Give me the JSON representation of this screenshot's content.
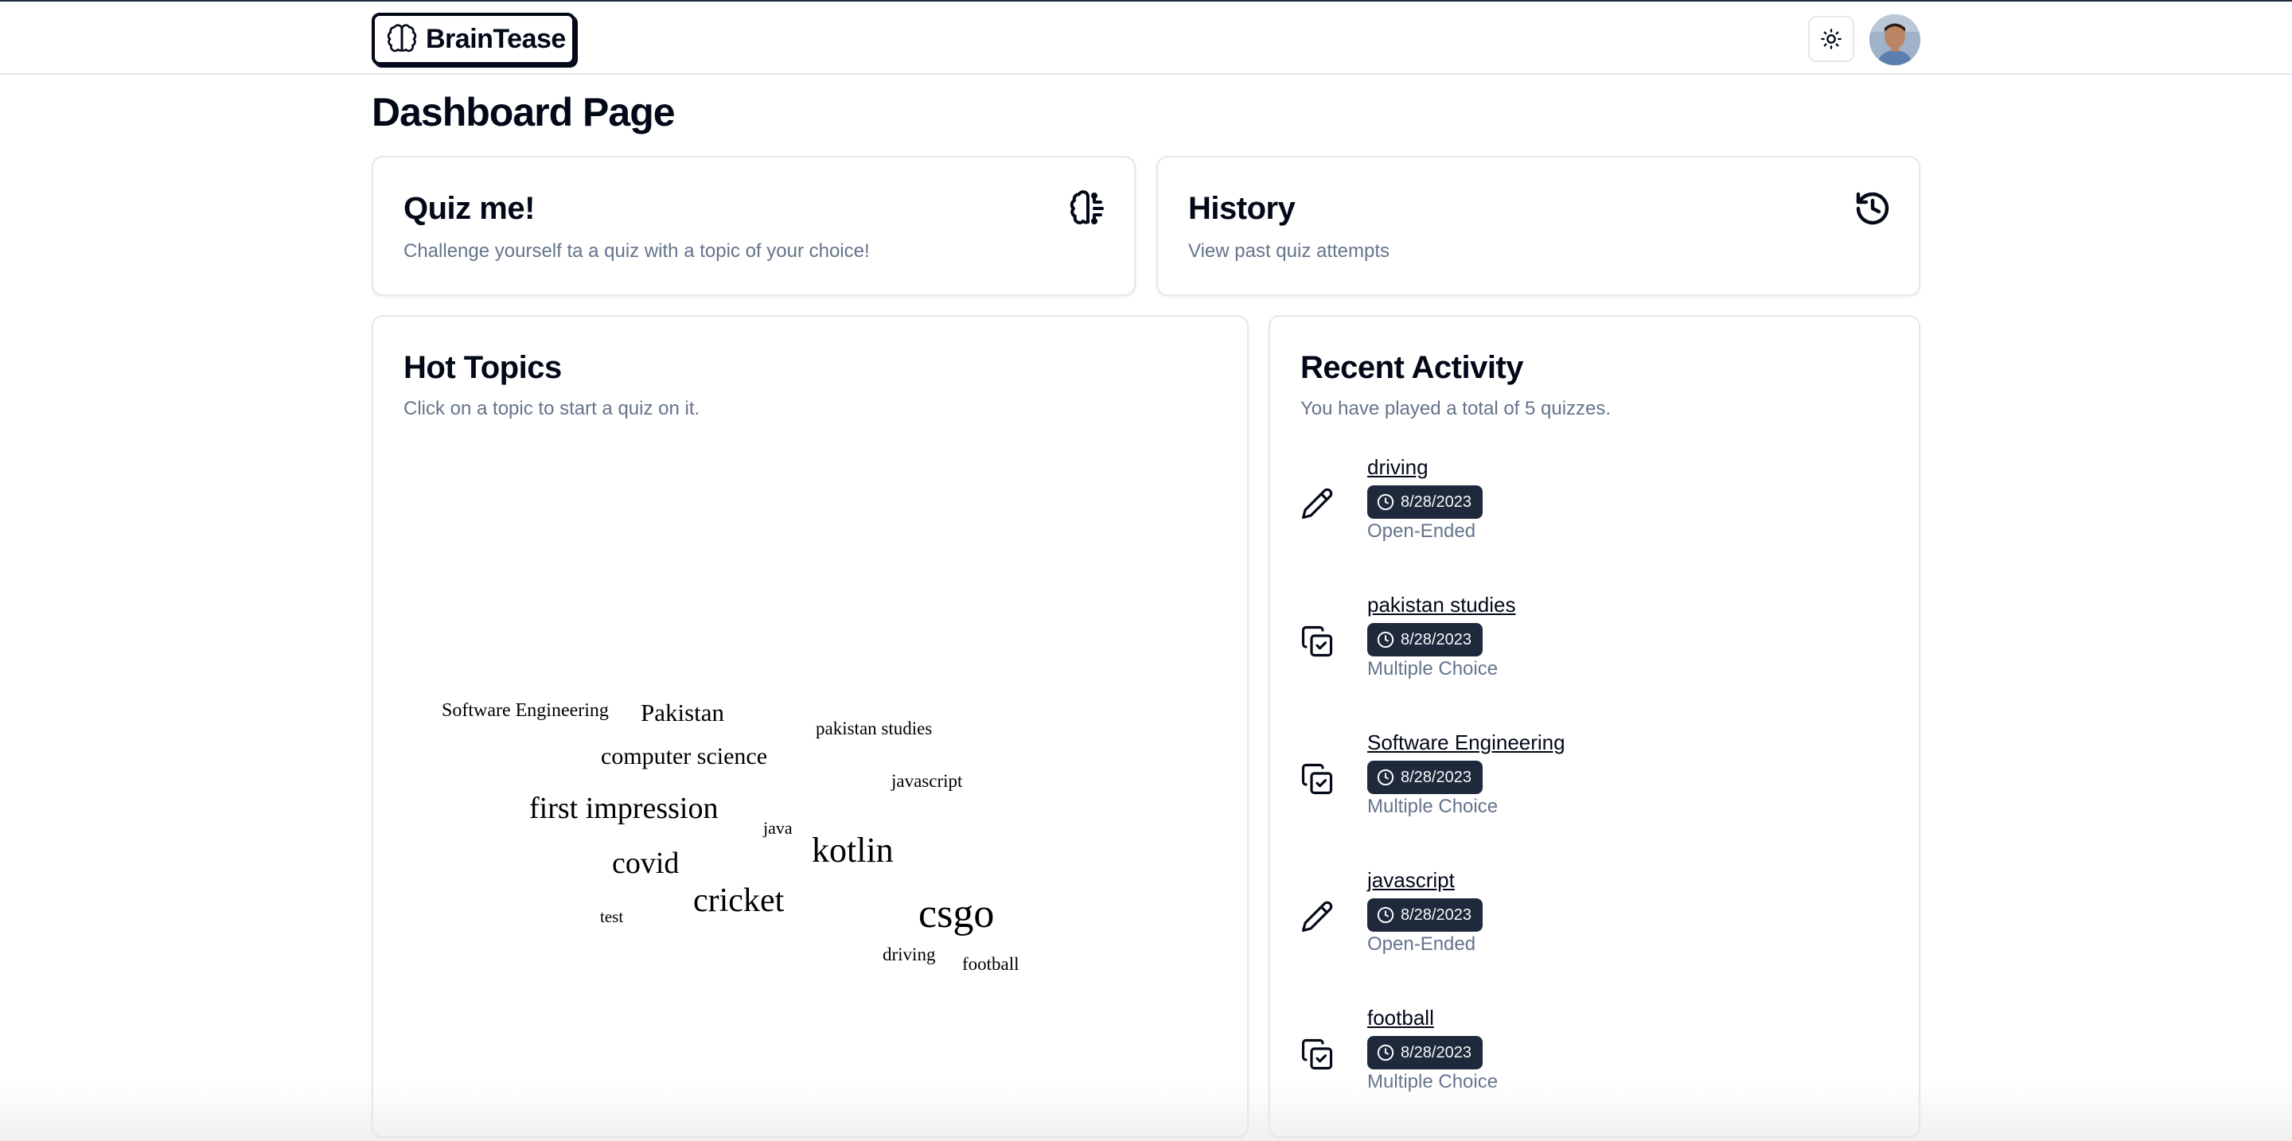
{
  "app": {
    "name": "BrainTease"
  },
  "page": {
    "title": "Dashboard Page"
  },
  "quiz_card": {
    "title": "Quiz me!",
    "description": "Challenge yourself ta a quiz with a topic of your choice!",
    "icon": "brain-circuit-icon"
  },
  "history_card": {
    "title": "History",
    "description": "View past quiz attempts",
    "icon": "history-icon"
  },
  "hot_topics": {
    "title": "Hot Topics",
    "description": "Click on a topic to start a quiz on it.",
    "words": [
      {
        "text": "Software Engineering"
      },
      {
        "text": "Pakistan"
      },
      {
        "text": "pakistan studies"
      },
      {
        "text": "computer science"
      },
      {
        "text": "javascript"
      },
      {
        "text": "first impression"
      },
      {
        "text": "java"
      },
      {
        "text": "kotlin"
      },
      {
        "text": "covid"
      },
      {
        "text": "cricket"
      },
      {
        "text": "csgo"
      },
      {
        "text": "test"
      },
      {
        "text": "driving"
      },
      {
        "text": "football"
      }
    ]
  },
  "recent_activity": {
    "title": "Recent Activity",
    "description": "You have played a total of 5 quizzes.",
    "items": [
      {
        "topic": "driving",
        "date": "8/28/2023",
        "type": "Open-Ended",
        "icon": "pencil-icon"
      },
      {
        "topic": "pakistan studies",
        "date": "8/28/2023",
        "type": "Multiple Choice",
        "icon": "copy-check-icon"
      },
      {
        "topic": "Software Engineering",
        "date": "8/28/2023",
        "type": "Multiple Choice",
        "icon": "copy-check-icon"
      },
      {
        "topic": "javascript",
        "date": "8/28/2023",
        "type": "Open-Ended",
        "icon": "pencil-icon"
      },
      {
        "topic": "football",
        "date": "8/28/2023",
        "type": "Multiple Choice",
        "icon": "copy-check-icon"
      }
    ]
  }
}
